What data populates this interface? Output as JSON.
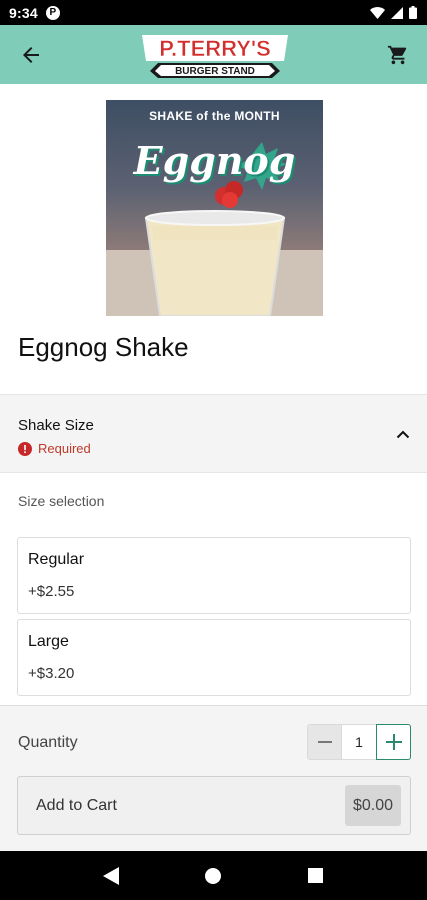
{
  "status_bar": {
    "time": "9:34",
    "app_icon": "P"
  },
  "header": {
    "back_icon": "arrow-left-icon",
    "cart_icon": "cart-icon",
    "logo": {
      "line1": "P.TERRY'S",
      "line2": "BURGER STAND"
    },
    "colors": {
      "background": "#7fcdb8",
      "logo_red": "#d32f2f"
    }
  },
  "product": {
    "image": {
      "promo_top": "SHAKE of the MONTH",
      "promo_title": "Eggnog"
    },
    "title": "Eggnog Shake"
  },
  "modifier_group": {
    "title": "Shake Size",
    "required_label": "Required",
    "expanded": true,
    "selection_label": "Size selection",
    "options": [
      {
        "name": "Regular",
        "price": "+$2.55"
      },
      {
        "name": "Large",
        "price": "+$3.20"
      }
    ]
  },
  "order": {
    "quantity_label": "Quantity",
    "quantity": "1",
    "add_to_cart_label": "Add to Cart",
    "total": "$0.00",
    "accent_color": "#2b8a6e"
  }
}
